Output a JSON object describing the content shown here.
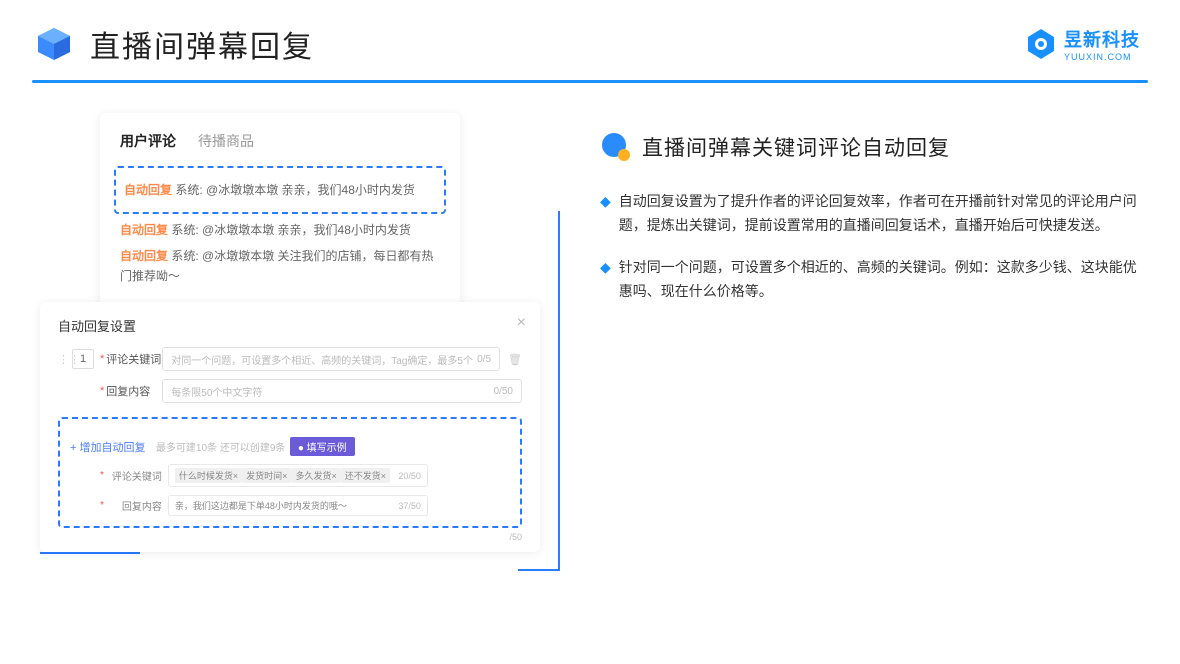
{
  "header": {
    "title": "直播间弹幕回复",
    "brand": {
      "name": "昱新科技",
      "sub": "YUUXIN.COM"
    }
  },
  "top_card": {
    "tab_active": "用户评论",
    "tab_inactive": "待播商品",
    "msg1": {
      "auto": "自动回复",
      "text": " 系统: @冰墩墩本墩 亲亲，我们48小时内发货"
    },
    "msg2": {
      "auto": "自动回复",
      "text": " 系统: @冰墩墩本墩 亲亲，我们48小时内发货"
    },
    "msg3": {
      "auto": "自动回复",
      "text": " 系统: @冰墩墩本墩 关注我们的店铺，每日都有热门推荐呦～"
    }
  },
  "modal": {
    "title": "自动回复设置",
    "num": "1",
    "row1_label": "评论关键词",
    "row1_placeholder": "对同一个问题，可设置多个相近、高频的关键词，Tag确定，最多5个",
    "row1_counter": "0/5",
    "row2_label": "回复内容",
    "row2_placeholder": "每条限50个中文字符",
    "row2_counter": "0/50",
    "add_link": "+ 增加自动回复",
    "add_hint": "最多可建10条 还可以创建9条",
    "badge": "● 填写示例",
    "ex1_label": "评论关键词",
    "tags": [
      "什么时候发货×",
      "发货时间×",
      "多久发货×",
      "还不发货×"
    ],
    "ex1_counter": "20/50",
    "ex2_label": "回复内容",
    "ex2_text": "亲，我们这边都是下单48小时内发货的哦～",
    "ex2_counter": "37/50",
    "bottom_counter": "/50"
  },
  "right": {
    "title": "直播间弹幕关键词评论自动回复",
    "bullets": [
      "自动回复设置为了提升作者的评论回复效率，作者可在开播前针对常见的评论用户问题，提炼出关键词，提前设置常用的直播间回复话术，直播开始后可快捷发送。",
      "针对同一个问题，可设置多个相近的、高频的关键词。例如：这款多少钱、这块能优惠吗、现在什么价格等。"
    ]
  }
}
